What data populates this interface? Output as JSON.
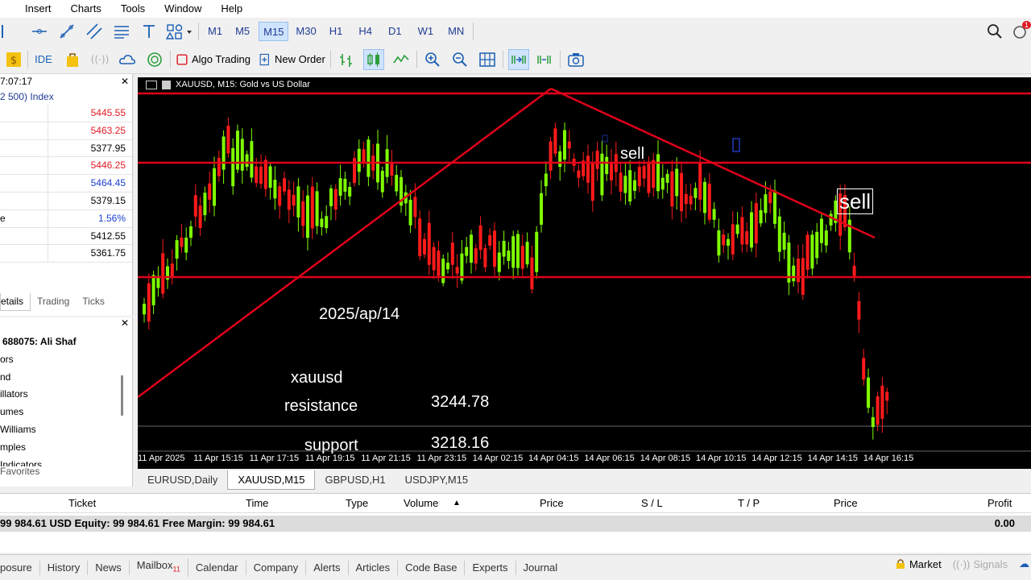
{
  "menu": [
    "Insert",
    "Charts",
    "Tools",
    "Window",
    "Help"
  ],
  "timeframes": [
    "M1",
    "M5",
    "M15",
    "M30",
    "H1",
    "H4",
    "D1",
    "W1",
    "MN"
  ],
  "selected_timeframe": "M15",
  "toolbar2": {
    "ide": "IDE",
    "algo_trading": "Algo Trading",
    "new_order": "New Order"
  },
  "notification_count": "1",
  "market_watch": {
    "time": "7:07:17",
    "index_label": "2 500) Index",
    "rows": [
      {
        "label": "",
        "value": "5445.55",
        "color": "#e01b24"
      },
      {
        "label": "",
        "value": "5463.25",
        "color": "#e01b24"
      },
      {
        "label": "",
        "value": "5377.95",
        "color": "#000000"
      },
      {
        "label": "",
        "value": "5446.25",
        "color": "#e01b24"
      },
      {
        "label": "",
        "value": "5464.45",
        "color": "#1c3fd0"
      },
      {
        "label": "",
        "value": "5379.15",
        "color": "#000000"
      },
      {
        "label": "e",
        "value": "1.56%",
        "color": "#1c3fd0"
      },
      {
        "label": "",
        "value": "5412.55",
        "color": "#000000"
      },
      {
        "label": "",
        "value": "5361.75",
        "color": "#000000"
      }
    ],
    "tabs": [
      "etails",
      "Trading",
      "Ticks"
    ]
  },
  "navigator": {
    "items": [
      "688075: Ali Shaf",
      "ors",
      "nd",
      "illators",
      "umes",
      "Williams",
      "mples",
      "Indicators"
    ],
    "favorites": "Favorites"
  },
  "chart": {
    "title": "XAUUSD, M15:  Gold vs US Dollar",
    "x_ticks": [
      "11 Apr 2025",
      "11 Apr 15:15",
      "11 Apr 17:15",
      "11 Apr 19:15",
      "11 Apr 21:15",
      "11 Apr 23:15",
      "14 Apr 02:15",
      "14 Apr 04:15",
      "14 Apr 06:15",
      "14 Apr 08:15",
      "14 Apr 10:15",
      "14 Apr 12:15",
      "14 Apr 14:15",
      "14 Apr 16:15"
    ],
    "annotations": {
      "date": "2025/ap/14",
      "symbol": "xauusd",
      "resistance_label": "resistance",
      "resistance_value": "3244.78",
      "support_label": "support",
      "support_value": "3218.16",
      "sell1": "sell",
      "sell2": "sell"
    },
    "bull_color": "#7fff00",
    "bear_color": "#ff1a1a",
    "line_color": "#e0001a"
  },
  "chart_tabs": [
    "EURUSD,Daily",
    "XAUUSD,M15",
    "GBPUSD,H1",
    "USDJPY,M15"
  ],
  "active_chart_tab": "XAUUSD,M15",
  "trade": {
    "headers": [
      "Ticket",
      "Time",
      "Type",
      "Volume",
      "Price",
      "S / L",
      "T / P",
      "Price",
      "Profit"
    ],
    "balance_line": "99 984.61 USD  Equity: 99 984.61  Free Margin: 99 984.61",
    "profit": "0.00"
  },
  "bottom_tabs": [
    "posure",
    "History",
    "News",
    "Mailbox",
    "Calendar",
    "Company",
    "Alerts",
    "Articles",
    "Code Base",
    "Experts",
    "Journal"
  ],
  "mailbox_count": "11",
  "status": {
    "market": "Market",
    "signals": "Signals"
  }
}
